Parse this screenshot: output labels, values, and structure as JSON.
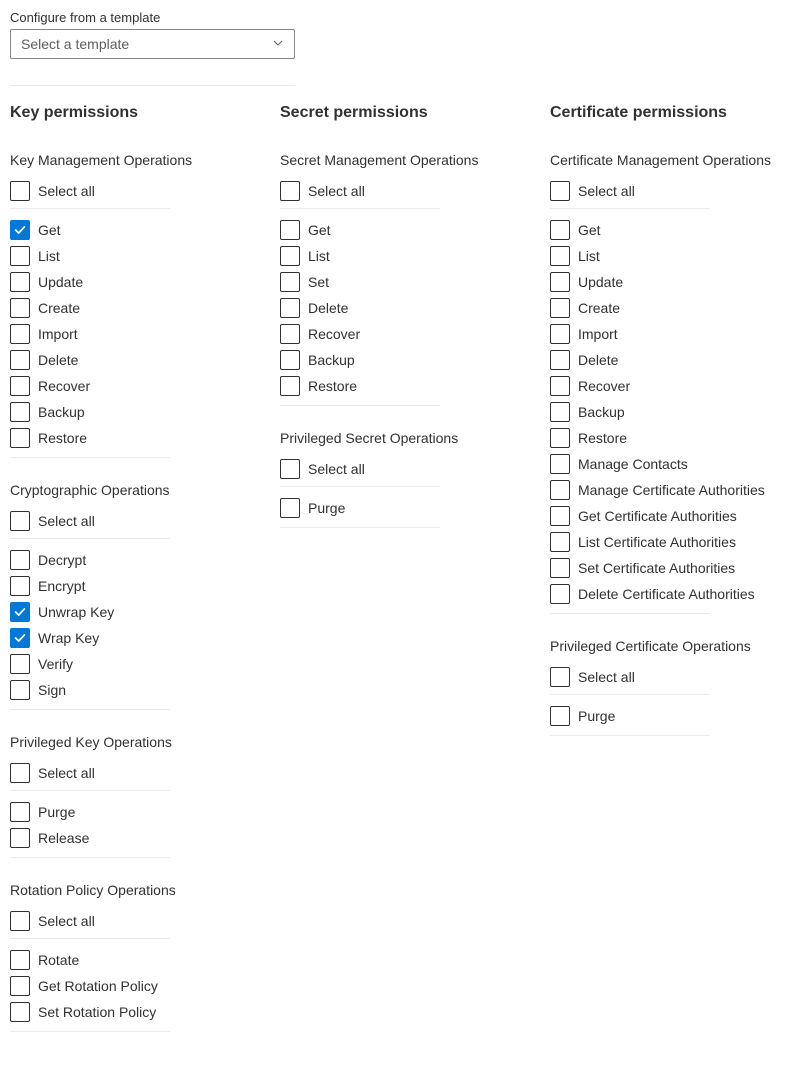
{
  "template": {
    "label": "Configure from a template",
    "placeholder": "Select a template"
  },
  "columns": [
    {
      "title": "Key permissions",
      "groups": [
        {
          "title": "Key Management Operations",
          "selectAllLabel": "Select all",
          "items": [
            {
              "label": "Get",
              "checked": true
            },
            {
              "label": "List",
              "checked": false
            },
            {
              "label": "Update",
              "checked": false
            },
            {
              "label": "Create",
              "checked": false
            },
            {
              "label": "Import",
              "checked": false
            },
            {
              "label": "Delete",
              "checked": false
            },
            {
              "label": "Recover",
              "checked": false
            },
            {
              "label": "Backup",
              "checked": false
            },
            {
              "label": "Restore",
              "checked": false
            }
          ]
        },
        {
          "title": "Cryptographic Operations",
          "selectAllLabel": "Select all",
          "items": [
            {
              "label": "Decrypt",
              "checked": false
            },
            {
              "label": "Encrypt",
              "checked": false
            },
            {
              "label": "Unwrap Key",
              "checked": true
            },
            {
              "label": "Wrap Key",
              "checked": true
            },
            {
              "label": "Verify",
              "checked": false
            },
            {
              "label": "Sign",
              "checked": false
            }
          ]
        },
        {
          "title": "Privileged Key Operations",
          "selectAllLabel": "Select all",
          "items": [
            {
              "label": "Purge",
              "checked": false
            },
            {
              "label": "Release",
              "checked": false
            }
          ]
        },
        {
          "title": "Rotation Policy Operations",
          "selectAllLabel": "Select all",
          "items": [
            {
              "label": "Rotate",
              "checked": false
            },
            {
              "label": "Get Rotation Policy",
              "checked": false
            },
            {
              "label": "Set Rotation Policy",
              "checked": false
            }
          ]
        }
      ]
    },
    {
      "title": "Secret permissions",
      "groups": [
        {
          "title": "Secret Management Operations",
          "selectAllLabel": "Select all",
          "items": [
            {
              "label": "Get",
              "checked": false
            },
            {
              "label": "List",
              "checked": false
            },
            {
              "label": "Set",
              "checked": false
            },
            {
              "label": "Delete",
              "checked": false
            },
            {
              "label": "Recover",
              "checked": false
            },
            {
              "label": "Backup",
              "checked": false
            },
            {
              "label": "Restore",
              "checked": false
            }
          ]
        },
        {
          "title": "Privileged Secret Operations",
          "selectAllLabel": "Select all",
          "items": [
            {
              "label": "Purge",
              "checked": false
            }
          ]
        }
      ]
    },
    {
      "title": "Certificate permissions",
      "groups": [
        {
          "title": "Certificate Management Operations",
          "selectAllLabel": "Select all",
          "items": [
            {
              "label": "Get",
              "checked": false
            },
            {
              "label": "List",
              "checked": false
            },
            {
              "label": "Update",
              "checked": false
            },
            {
              "label": "Create",
              "checked": false
            },
            {
              "label": "Import",
              "checked": false
            },
            {
              "label": "Delete",
              "checked": false
            },
            {
              "label": "Recover",
              "checked": false
            },
            {
              "label": "Backup",
              "checked": false
            },
            {
              "label": "Restore",
              "checked": false
            },
            {
              "label": "Manage Contacts",
              "checked": false
            },
            {
              "label": "Manage Certificate Authorities",
              "checked": false
            },
            {
              "label": "Get Certificate Authorities",
              "checked": false
            },
            {
              "label": "List Certificate Authorities",
              "checked": false
            },
            {
              "label": "Set Certificate Authorities",
              "checked": false
            },
            {
              "label": "Delete Certificate Authorities",
              "checked": false
            }
          ]
        },
        {
          "title": "Privileged Certificate Operations",
          "selectAllLabel": "Select all",
          "items": [
            {
              "label": "Purge",
              "checked": false
            }
          ]
        }
      ]
    }
  ]
}
